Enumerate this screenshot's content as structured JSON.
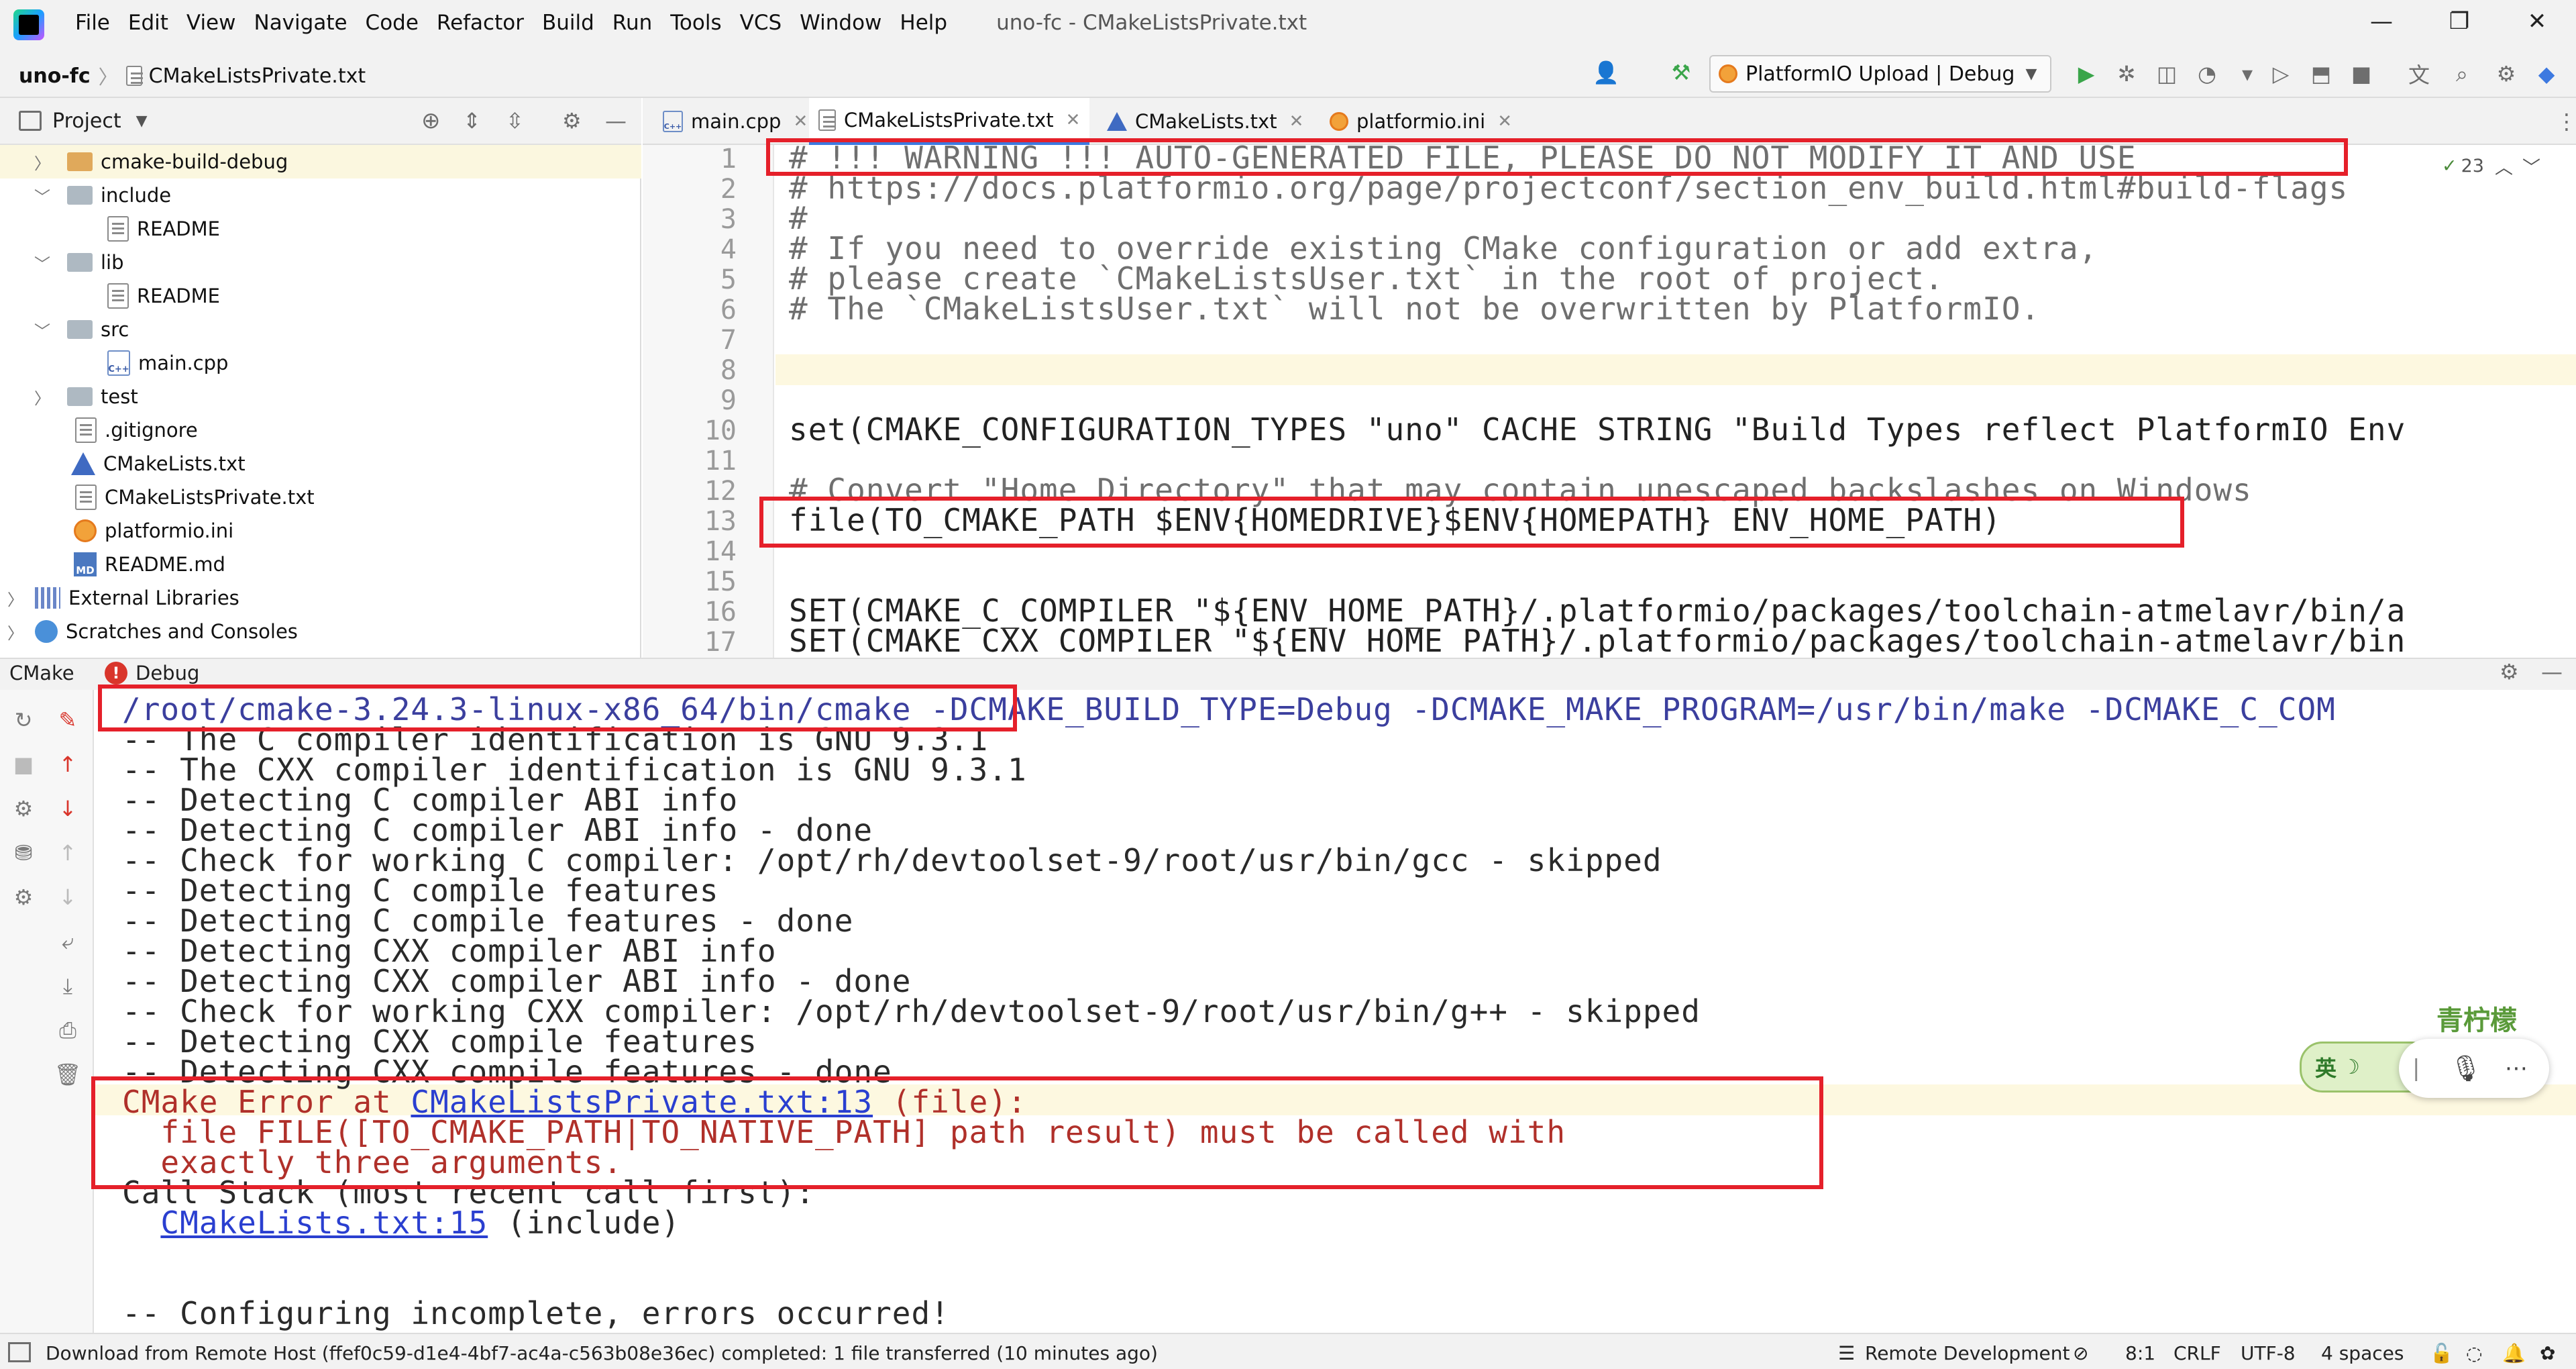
{
  "menu": {
    "items": [
      "File",
      "Edit",
      "View",
      "Navigate",
      "Code",
      "Refactor",
      "Build",
      "Run",
      "Tools",
      "VCS",
      "Window",
      "Help"
    ],
    "window_title": "uno-fc - CMakeListsPrivate.txt"
  },
  "breadcrumb": {
    "project": "uno-fc",
    "file": "CMakeListsPrivate.txt"
  },
  "run_config": {
    "label": "PlatformIO Upload | Debug"
  },
  "project_panel": {
    "title": "Project",
    "tree": [
      {
        "label": "cmake-build-debug"
      },
      {
        "label": "include"
      },
      {
        "label": "README"
      },
      {
        "label": "lib"
      },
      {
        "label": "README"
      },
      {
        "label": "src"
      },
      {
        "label": "main.cpp"
      },
      {
        "label": "test"
      },
      {
        "label": ".gitignore"
      },
      {
        "label": "CMakeLists.txt"
      },
      {
        "label": "CMakeListsPrivate.txt"
      },
      {
        "label": "platformio.ini"
      },
      {
        "label": "README.md"
      },
      {
        "label": "External Libraries"
      },
      {
        "label": "Scratches and Consoles"
      }
    ]
  },
  "editor": {
    "tabs": [
      {
        "label": "main.cpp"
      },
      {
        "label": "CMakeListsPrivate.txt"
      },
      {
        "label": "CMakeLists.txt"
      },
      {
        "label": "platformio.ini"
      }
    ],
    "inspection_count": "23",
    "lines": [
      {
        "n": "1",
        "text": "# !!! WARNING !!! AUTO-GENERATED FILE, PLEASE DO NOT MODIFY IT AND USE"
      },
      {
        "n": "2",
        "text": "# https://docs.platformio.org/page/projectconf/section_env_build.html#build-flags"
      },
      {
        "n": "3",
        "text": "#"
      },
      {
        "n": "4",
        "text": "# If you need to override existing CMake configuration or add extra,"
      },
      {
        "n": "5",
        "text": "# please create `CMakeListsUser.txt` in the root of project."
      },
      {
        "n": "6",
        "text": "# The `CMakeListsUser.txt` will not be overwritten by PlatformIO."
      },
      {
        "n": "7",
        "text": ""
      },
      {
        "n": "8",
        "text": ""
      },
      {
        "n": "9",
        "text": ""
      },
      {
        "n": "10",
        "text": "set(CMAKE_CONFIGURATION_TYPES \"uno\" CACHE STRING \"Build Types reflect PlatformIO Env"
      },
      {
        "n": "11",
        "text": ""
      },
      {
        "n": "12",
        "text": "# Convert \"Home Directory\" that may contain unescaped backslashes on Windows"
      },
      {
        "n": "13",
        "text": "file(TO_CMAKE_PATH $ENV{HOMEDRIVE}$ENV{HOMEPATH} ENV_HOME_PATH)"
      },
      {
        "n": "14",
        "text": ""
      },
      {
        "n": "15",
        "text": ""
      },
      {
        "n": "16",
        "text": "SET(CMAKE_C_COMPILER \"${ENV_HOME_PATH}/.platformio/packages/toolchain-atmelavr/bin/a"
      },
      {
        "n": "17",
        "text": "SET(CMAKE_CXX_COMPILER \"${ENV_HOME_PATH}/.platformio/packages/toolchain-atmelavr/bin"
      }
    ]
  },
  "bottom_panel": {
    "tabs": [
      "CMake",
      "Debug"
    ],
    "console": {
      "cmd_path": "/root/cmake-3.24.3-linux-x86_64/bin/cmake",
      "cmd_rest": " -DCMAKE_BUILD_TYPE=Debug -DCMAKE_MAKE_PROGRAM=/usr/bin/make -DCMAKE_C_COM",
      "lines": [
        "-- The C compiler identification is GNU 9.3.1",
        "-- The CXX compiler identification is GNU 9.3.1",
        "-- Detecting C compiler ABI info",
        "-- Detecting C compiler ABI info - done",
        "-- Check for working C compiler: /opt/rh/devtoolset-9/root/usr/bin/gcc - skipped",
        "-- Detecting C compile features",
        "-- Detecting C compile features - done",
        "-- Detecting CXX compiler ABI info",
        "-- Detecting CXX compiler ABI info - done",
        "-- Check for working CXX compiler: /opt/rh/devtoolset-9/root/usr/bin/g++ - skipped",
        "-- Detecting CXX compile features",
        "-- Detecting CXX compile features - done"
      ],
      "error_prefix": "CMake Error at ",
      "error_link": "CMakeListsPrivate.txt:13",
      "error_suffix": " (file):",
      "error_line2": "  file FILE([TO_CMAKE_PATH|TO_NATIVE_PATH] path result) must be called with",
      "error_line3": "  exactly three arguments.",
      "call_stack": "Call Stack (most recent call first):",
      "stack_link": "CMakeLists.txt:15",
      "stack_suffix": " (include)",
      "incomplete": "-- Configuring incomplete, errors occurred!"
    }
  },
  "status_bar": {
    "message": "Download from Remote Host (ffef0c59-d1e4-4bf7-ac4a-c563b08e36ec) completed: 1 file transferred (10 minutes ago)",
    "remote": "Remote Development",
    "position": "8:1",
    "line_sep": "CRLF",
    "encoding": "UTF-8",
    "indent": "4 spaces"
  },
  "overlay": {
    "ime_label": "英",
    "deco_text": "青柠檬"
  },
  "colors": {
    "accent": "#3d79e0",
    "error": "#b0302a",
    "highlight_box": "#e5202a",
    "run_green": "#3aa54a"
  }
}
